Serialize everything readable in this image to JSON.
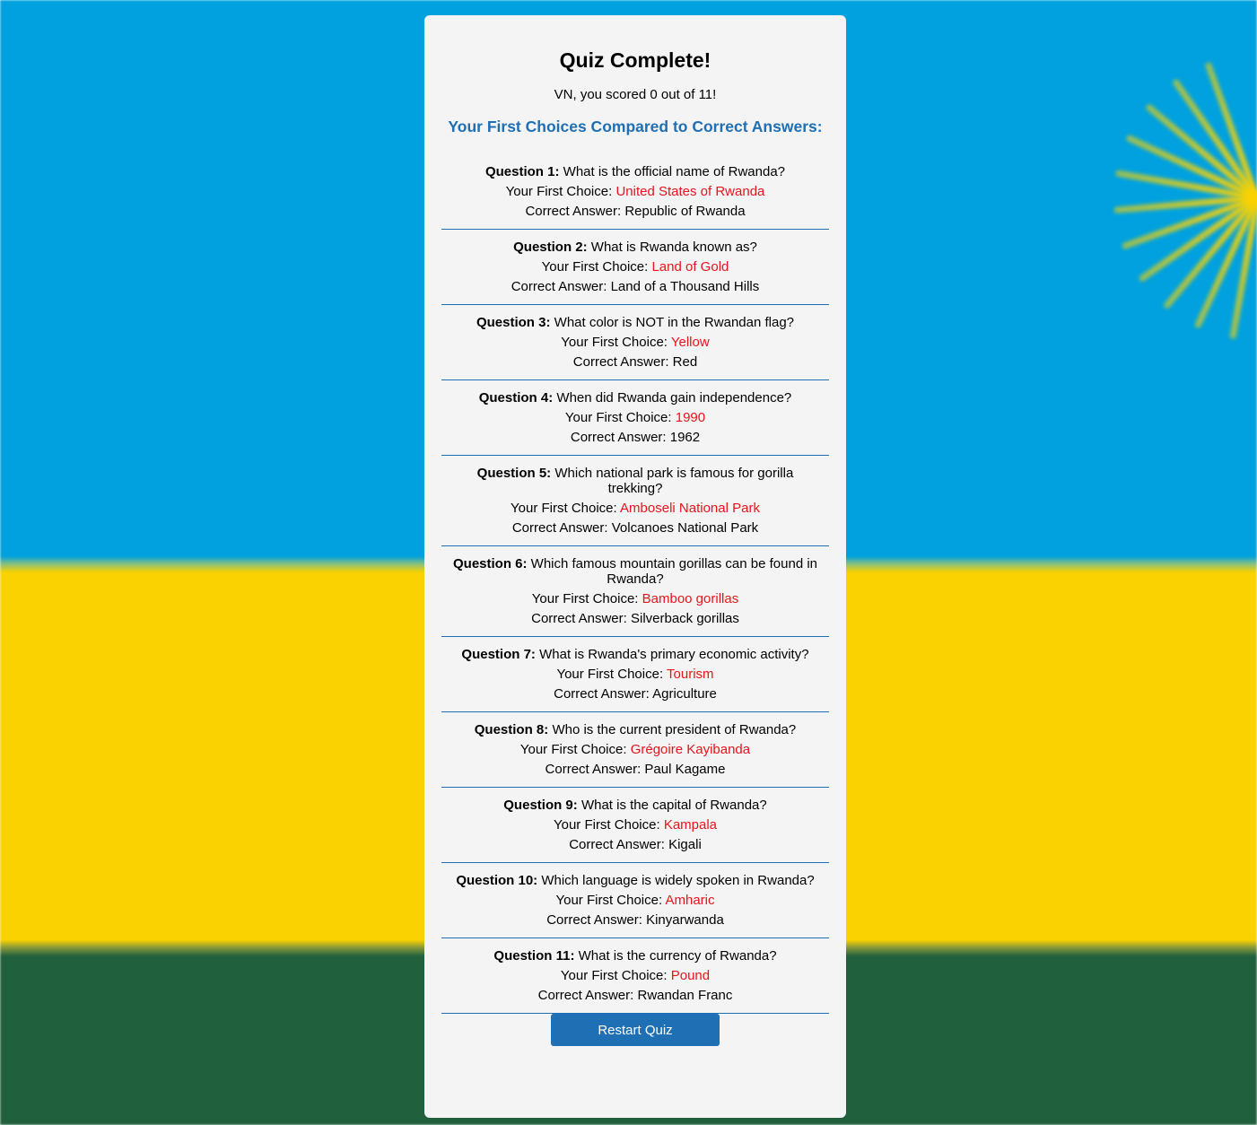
{
  "title": "Quiz Complete!",
  "score_text": "VN, you scored 0 out of 11!",
  "subtitle": "Your First Choices Compared to Correct Answers:",
  "first_choice_label": "Your First Choice:",
  "correct_answer_label": "Correct Answer:",
  "colors": {
    "accent": "#1f6fb4",
    "wrong": "#e8141c",
    "flag_blue": "#00a1de",
    "flag_yellow": "#fad201",
    "flag_green": "#20603d"
  },
  "results": [
    {
      "label": "Question 1:",
      "question": "What is the official name of Rwanda?",
      "first_choice": "United States of Rwanda",
      "correct": "Republic of Rwanda"
    },
    {
      "label": "Question 2:",
      "question": "What is Rwanda known as?",
      "first_choice": "Land of Gold",
      "correct": "Land of a Thousand Hills"
    },
    {
      "label": "Question 3:",
      "question": "What color is NOT in the Rwandan flag?",
      "first_choice": "Yellow",
      "correct": "Red"
    },
    {
      "label": "Question 4:",
      "question": "When did Rwanda gain independence?",
      "first_choice": "1990",
      "correct": "1962"
    },
    {
      "label": "Question 5:",
      "question": "Which national park is famous for gorilla trekking?",
      "first_choice": "Amboseli National Park",
      "correct": "Volcanoes National Park"
    },
    {
      "label": "Question 6:",
      "question": "Which famous mountain gorillas can be found in Rwanda?",
      "first_choice": "Bamboo gorillas",
      "correct": "Silverback gorillas"
    },
    {
      "label": "Question 7:",
      "question": "What is Rwanda's primary economic activity?",
      "first_choice": "Tourism",
      "correct": "Agriculture"
    },
    {
      "label": "Question 8:",
      "question": "Who is the current president of Rwanda?",
      "first_choice": "Grégoire Kayibanda",
      "correct": "Paul Kagame"
    },
    {
      "label": "Question 9:",
      "question": "What is the capital of Rwanda?",
      "first_choice": "Kampala",
      "correct": "Kigali"
    },
    {
      "label": "Question 10:",
      "question": "Which language is widely spoken in Rwanda?",
      "first_choice": "Amharic",
      "correct": "Kinyarwanda"
    },
    {
      "label": "Question 11:",
      "question": "What is the currency of Rwanda?",
      "first_choice": "Pound",
      "correct": "Rwandan Franc"
    }
  ],
  "restart_label": "Restart Quiz"
}
